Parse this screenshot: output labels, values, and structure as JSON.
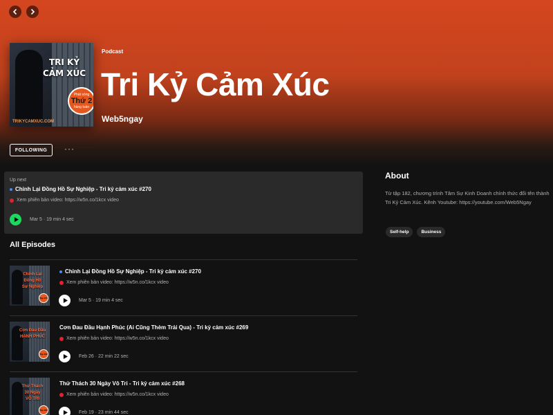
{
  "podcast": {
    "type_label": "Podcast",
    "title": "Tri Kỷ Cảm Xúc",
    "publisher": "Web5ngay",
    "cover": {
      "title": "TRI KỶ\nCẢM XÚC",
      "badge_top": "Phát sóng",
      "badge_main": "Thứ 2",
      "badge_bottom": "hàng tuần",
      "url": "TRIKYCAMXUC.COM"
    }
  },
  "actions": {
    "follow_label": "FOLLOWING",
    "more_label": "···"
  },
  "up_next": {
    "label": "Up next",
    "title": "Chỉnh Lại Đồng Hồ Sự Nghiệp - Tri kỷ cảm xúc #270",
    "desc": "Xem phiên bản video:  https://w5n.co/1kcx video",
    "meta": "Mar 5 · 19 min 4 sec"
  },
  "all_episodes": {
    "heading": "All Episodes",
    "items": [
      {
        "thumb_text": "Chỉnh Lại\nĐồng Hồ\nSự Nghiệp",
        "thumb_badge": "Tập 270",
        "title": "Chỉnh Lại Đồng Hồ Sự Nghiệp - Tri kỷ cảm xúc #270",
        "desc": "Xem phiên bản video:  https://w5n.co/1kcx video",
        "meta": "Mar 5 · 19 min 4 sec",
        "is_new": true
      },
      {
        "thumb_text": "Cơn Đau Đầu\nHẠNH PHÚC",
        "thumb_badge": "Tập 269",
        "title": "Cơn Đau Đầu Hạnh Phúc (Ai Cũng Thèm Trải Qua) - Tri kỷ cảm xúc #269",
        "desc": "Xem phiên bản video:  https://w5n.co/1kcx video",
        "meta": "Feb 26 · 22 min 22 sec",
        "is_new": false
      },
      {
        "thumb_text": "Thử Thách\n30 Ngày\nVÔ TRI",
        "thumb_badge": "Tập 268",
        "title": "Thử Thách 30 Ngày Vô Tri - Tri kỷ cảm xúc #268",
        "desc": "Xem phiên bản video:  https://w5n.co/1kcx video",
        "meta": "Feb 19 · 23 min 44 sec",
        "is_new": false
      }
    ]
  },
  "about": {
    "heading": "About",
    "text": "Từ tập 182, chương trình Tâm Sự Kinh Doanh chính thức đổi tên thành Tri Kỷ Cảm Xúc. Kênh Youtube: https://youtube.com/Web5Ngay",
    "tags": [
      "Self-help",
      "Business"
    ]
  },
  "colors": {
    "hero": "#d4461f",
    "play_green": "#1ed760",
    "new_dot": "#4a8df8",
    "video_dot": "#e22134",
    "background": "#121212"
  },
  "icons": {
    "back": "chevron-left-icon",
    "forward": "chevron-right-icon",
    "play": "play-icon"
  }
}
